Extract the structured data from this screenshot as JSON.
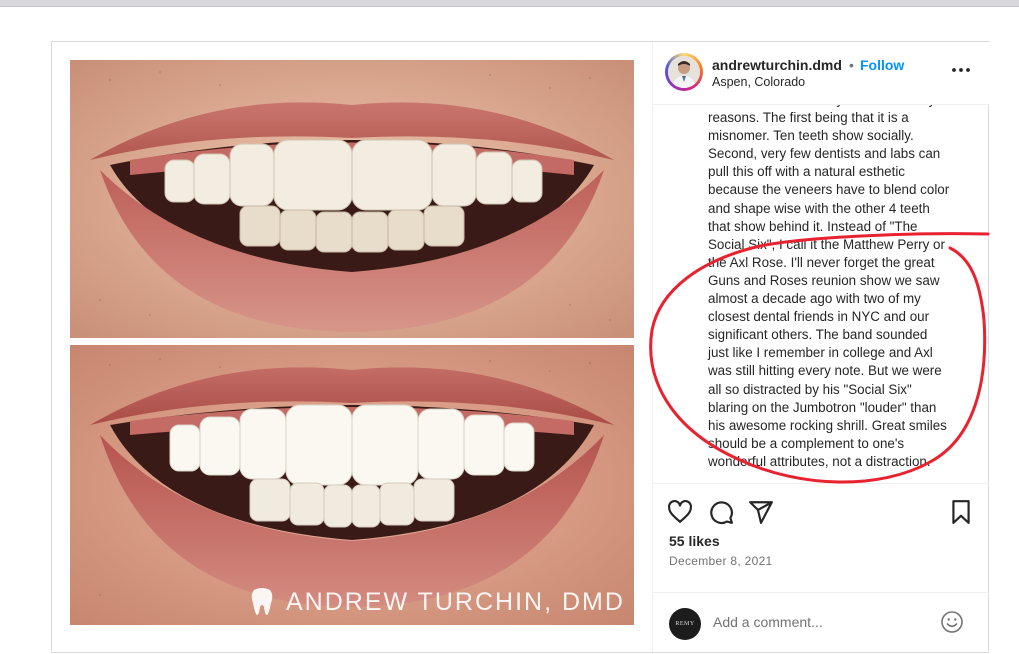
{
  "post": {
    "username": "andrewturchin.dmd",
    "separator": "•",
    "follow_label": "Follow",
    "location": "Aspen, Colorado",
    "watermark": "ANDREW TURCHIN, DMD",
    "caption_lines": [
      "It's a number we rarely do for so many",
      "reasons. The first being that it is a",
      "misnomer. Ten teeth show socially.",
      "Second, very few dentists and labs can",
      "pull this off with a natural esthetic",
      "because the veneers have to blend color",
      "and shape wise with the other 4 teeth",
      "that show behind it. Instead of \"The",
      "Social Six\", I call it the Matthew Perry or",
      "the Axl Rose. I'll never forget the great",
      "Guns and Roses reunion show we saw",
      "almost a decade ago with two of my",
      "closest dental friends in NYC and our",
      "significant others. The band sounded",
      "just like I remember in college and Axl",
      "was still hitting every note. But we were",
      "all so distracted by his \"Social Six\"",
      "blaring on the Jumbotron \"louder\" than",
      "his awesome rocking shrill. Great smiles",
      "should be a complement to one's",
      "wonderful attributes, not a distraction."
    ],
    "likes": "55 likes",
    "date": "December 8, 2021",
    "comment_placeholder": "Add a comment...",
    "commenter_avatar_text": "REMY"
  },
  "icons": {
    "like": "heart-icon",
    "comment": "comment-icon",
    "share": "share-icon",
    "save": "bookmark-icon",
    "more": "more-icon",
    "emoji": "emoji-icon",
    "logo": "tooth-icon"
  },
  "colors": {
    "follow": "#0095f6",
    "annotation": "#e8232f",
    "text": "#262626",
    "muted": "#737373"
  }
}
